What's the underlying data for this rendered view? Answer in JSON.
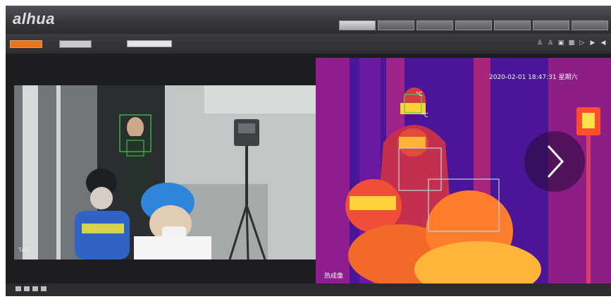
{
  "app": {
    "logo": "alhua",
    "nav_tabs": [
      "",
      "",
      "",
      "",
      "",
      "",
      ""
    ],
    "active_tab": 0
  },
  "toolbar": {
    "left_button": "",
    "right_button": "",
    "channel_label": "",
    "channel_value": "",
    "icons": [
      "person-icon",
      "person-icon",
      "record-icon",
      "capture-icon",
      "voice-icon",
      "talk-icon",
      "audio-icon"
    ]
  },
  "thermal": {
    "timestamp": "2020-02-01 18:47:31 星期六",
    "channel_caption": "热成像",
    "temp_labels": [
      "°C",
      "°C"
    ]
  },
  "visible": {
    "osd": "TAD"
  },
  "bottom_bar": {
    "icons": [
      "layout-1-icon",
      "layout-4-icon",
      "fullscreen-icon",
      "settings-icon"
    ]
  },
  "colors": {
    "accent": "#e8741e",
    "thermal_hot": "#ffd23a",
    "detection_box": "#3fd24a"
  }
}
